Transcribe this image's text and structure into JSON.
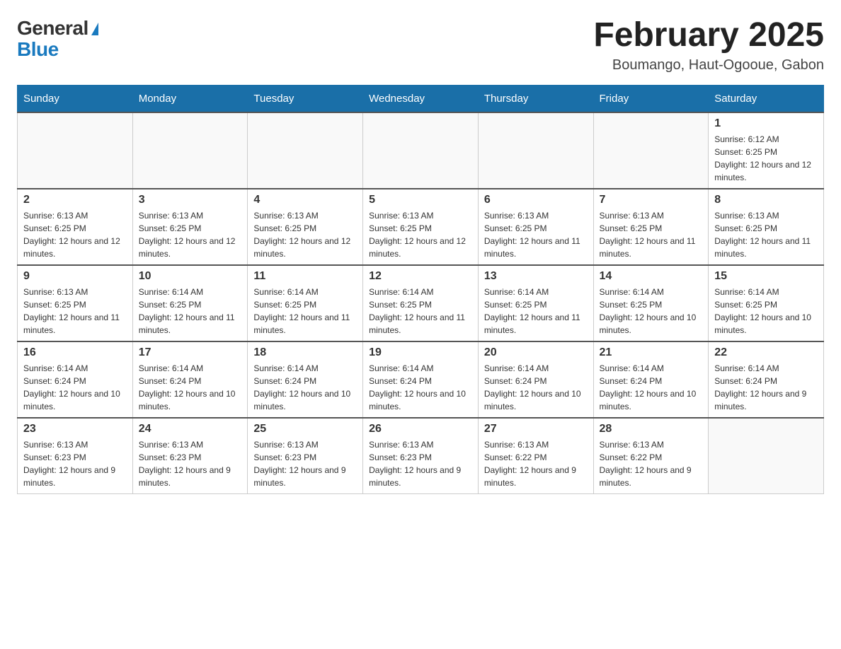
{
  "logo": {
    "general": "General",
    "blue": "Blue"
  },
  "title": "February 2025",
  "location": "Boumango, Haut-Ogooue, Gabon",
  "days_of_week": [
    "Sunday",
    "Monday",
    "Tuesday",
    "Wednesday",
    "Thursday",
    "Friday",
    "Saturday"
  ],
  "weeks": [
    [
      {
        "day": "",
        "info": ""
      },
      {
        "day": "",
        "info": ""
      },
      {
        "day": "",
        "info": ""
      },
      {
        "day": "",
        "info": ""
      },
      {
        "day": "",
        "info": ""
      },
      {
        "day": "",
        "info": ""
      },
      {
        "day": "1",
        "info": "Sunrise: 6:12 AM\nSunset: 6:25 PM\nDaylight: 12 hours and 12 minutes."
      }
    ],
    [
      {
        "day": "2",
        "info": "Sunrise: 6:13 AM\nSunset: 6:25 PM\nDaylight: 12 hours and 12 minutes."
      },
      {
        "day": "3",
        "info": "Sunrise: 6:13 AM\nSunset: 6:25 PM\nDaylight: 12 hours and 12 minutes."
      },
      {
        "day": "4",
        "info": "Sunrise: 6:13 AM\nSunset: 6:25 PM\nDaylight: 12 hours and 12 minutes."
      },
      {
        "day": "5",
        "info": "Sunrise: 6:13 AM\nSunset: 6:25 PM\nDaylight: 12 hours and 12 minutes."
      },
      {
        "day": "6",
        "info": "Sunrise: 6:13 AM\nSunset: 6:25 PM\nDaylight: 12 hours and 11 minutes."
      },
      {
        "day": "7",
        "info": "Sunrise: 6:13 AM\nSunset: 6:25 PM\nDaylight: 12 hours and 11 minutes."
      },
      {
        "day": "8",
        "info": "Sunrise: 6:13 AM\nSunset: 6:25 PM\nDaylight: 12 hours and 11 minutes."
      }
    ],
    [
      {
        "day": "9",
        "info": "Sunrise: 6:13 AM\nSunset: 6:25 PM\nDaylight: 12 hours and 11 minutes."
      },
      {
        "day": "10",
        "info": "Sunrise: 6:14 AM\nSunset: 6:25 PM\nDaylight: 12 hours and 11 minutes."
      },
      {
        "day": "11",
        "info": "Sunrise: 6:14 AM\nSunset: 6:25 PM\nDaylight: 12 hours and 11 minutes."
      },
      {
        "day": "12",
        "info": "Sunrise: 6:14 AM\nSunset: 6:25 PM\nDaylight: 12 hours and 11 minutes."
      },
      {
        "day": "13",
        "info": "Sunrise: 6:14 AM\nSunset: 6:25 PM\nDaylight: 12 hours and 11 minutes."
      },
      {
        "day": "14",
        "info": "Sunrise: 6:14 AM\nSunset: 6:25 PM\nDaylight: 12 hours and 10 minutes."
      },
      {
        "day": "15",
        "info": "Sunrise: 6:14 AM\nSunset: 6:25 PM\nDaylight: 12 hours and 10 minutes."
      }
    ],
    [
      {
        "day": "16",
        "info": "Sunrise: 6:14 AM\nSunset: 6:24 PM\nDaylight: 12 hours and 10 minutes."
      },
      {
        "day": "17",
        "info": "Sunrise: 6:14 AM\nSunset: 6:24 PM\nDaylight: 12 hours and 10 minutes."
      },
      {
        "day": "18",
        "info": "Sunrise: 6:14 AM\nSunset: 6:24 PM\nDaylight: 12 hours and 10 minutes."
      },
      {
        "day": "19",
        "info": "Sunrise: 6:14 AM\nSunset: 6:24 PM\nDaylight: 12 hours and 10 minutes."
      },
      {
        "day": "20",
        "info": "Sunrise: 6:14 AM\nSunset: 6:24 PM\nDaylight: 12 hours and 10 minutes."
      },
      {
        "day": "21",
        "info": "Sunrise: 6:14 AM\nSunset: 6:24 PM\nDaylight: 12 hours and 10 minutes."
      },
      {
        "day": "22",
        "info": "Sunrise: 6:14 AM\nSunset: 6:24 PM\nDaylight: 12 hours and 9 minutes."
      }
    ],
    [
      {
        "day": "23",
        "info": "Sunrise: 6:13 AM\nSunset: 6:23 PM\nDaylight: 12 hours and 9 minutes."
      },
      {
        "day": "24",
        "info": "Sunrise: 6:13 AM\nSunset: 6:23 PM\nDaylight: 12 hours and 9 minutes."
      },
      {
        "day": "25",
        "info": "Sunrise: 6:13 AM\nSunset: 6:23 PM\nDaylight: 12 hours and 9 minutes."
      },
      {
        "day": "26",
        "info": "Sunrise: 6:13 AM\nSunset: 6:23 PM\nDaylight: 12 hours and 9 minutes."
      },
      {
        "day": "27",
        "info": "Sunrise: 6:13 AM\nSunset: 6:22 PM\nDaylight: 12 hours and 9 minutes."
      },
      {
        "day": "28",
        "info": "Sunrise: 6:13 AM\nSunset: 6:22 PM\nDaylight: 12 hours and 9 minutes."
      },
      {
        "day": "",
        "info": ""
      }
    ]
  ]
}
